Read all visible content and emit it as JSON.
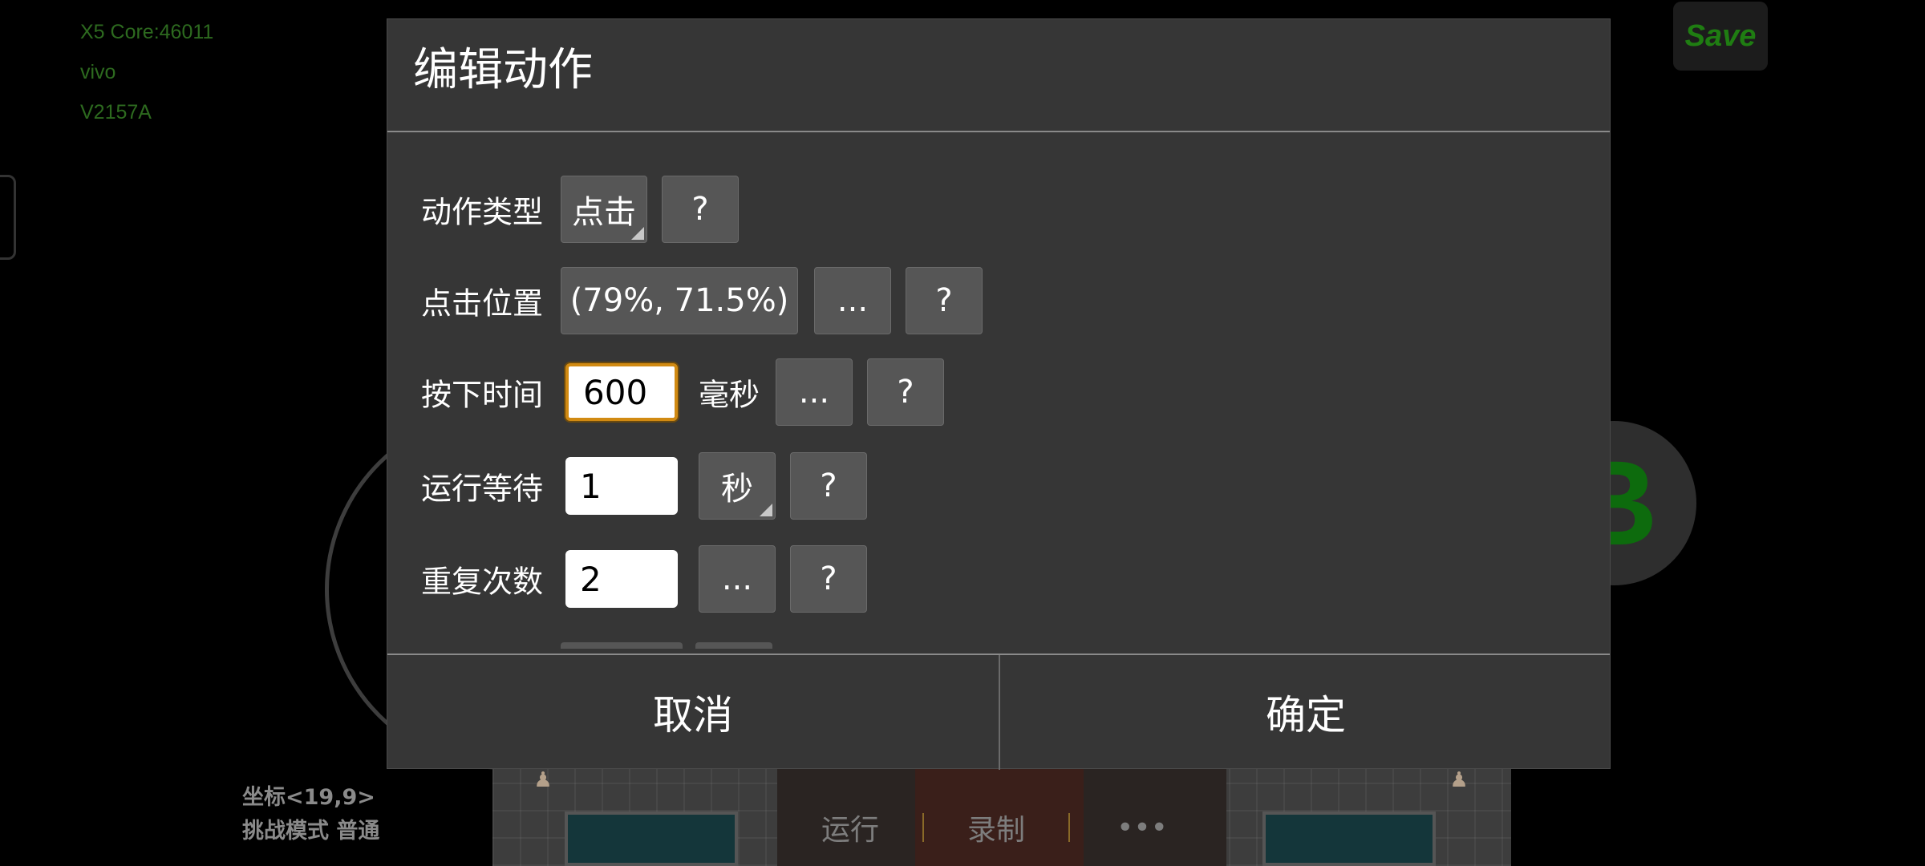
{
  "device_info": {
    "line1": "X5  Core:46011",
    "line2": "vivo",
    "line3": "V2157A"
  },
  "save_button": "Save",
  "b_button": "B",
  "status": {
    "coordinate": "坐标<19,9>",
    "mode": "挑战模式 普通"
  },
  "bottom_bar": {
    "run": "运行",
    "record": "录制",
    "more": "•••"
  },
  "dialog": {
    "title": "编辑动作",
    "help_label": "?",
    "more_label": "...",
    "rows": {
      "action_type": {
        "label": "动作类型",
        "value": "点击"
      },
      "click_position": {
        "label": "点击位置",
        "value": "(79%,  71.5%)"
      },
      "press_time": {
        "label": "按下时间",
        "value": "600",
        "unit": "毫秒"
      },
      "run_wait": {
        "label": "运行等待",
        "value": "1",
        "unit": "秒"
      },
      "repeat_count": {
        "label": "重复次数",
        "value": "2"
      }
    },
    "cancel": "取消",
    "confirm": "确定"
  }
}
